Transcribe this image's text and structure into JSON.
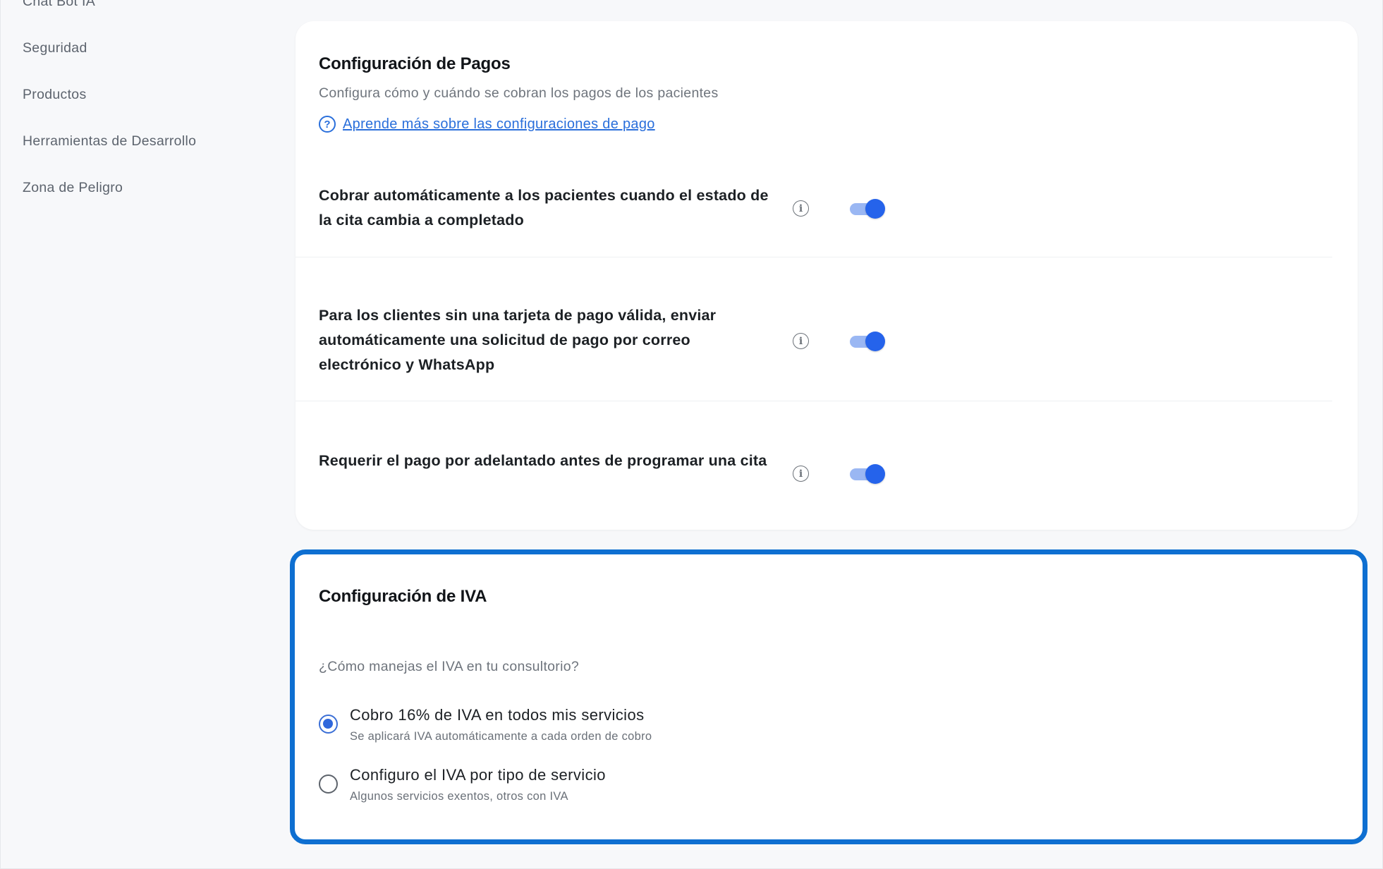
{
  "sidebar": {
    "items": [
      {
        "label": "Chat Bot IA"
      },
      {
        "label": "Seguridad"
      },
      {
        "label": "Productos"
      },
      {
        "label": "Herramientas de Desarrollo"
      },
      {
        "label": "Zona de Peligro"
      }
    ]
  },
  "pagos": {
    "title": "Configuración de Pagos",
    "subtitle": "Configura cómo y cuándo se cobran los pagos de los pacientes",
    "help_link": "Aprende más sobre las configuraciones de pago",
    "settings": [
      {
        "label": "Cobrar automáticamente a los pacientes cuando el estado de la cita cambia a completado",
        "enabled": true
      },
      {
        "label": "Para los clientes sin una tarjeta de pago válida, enviar automáticamente una solicitud de pago por correo electrónico y WhatsApp",
        "enabled": true
      },
      {
        "label": "Requerir el pago por adelantado antes de programar una cita",
        "enabled": true
      }
    ]
  },
  "iva": {
    "title": "Configuración de IVA",
    "question": "¿Cómo manejas el IVA en tu consultorio?",
    "options": [
      {
        "label": "Cobro 16% de IVA en todos mis servicios",
        "hint": "Se aplicará IVA automáticamente a cada orden de cobro",
        "selected": true
      },
      {
        "label": "Configuro el IVA por tipo de servicio",
        "hint": "Algunos servicios exentos, otros con IVA",
        "selected": false
      }
    ]
  },
  "colors": {
    "accent": "#2563eb",
    "highlight_border": "#0e6fd1",
    "toggle_track": "#9ab7f3"
  },
  "icons": {
    "help": "question-circle-icon",
    "info": "info-circle-icon"
  }
}
